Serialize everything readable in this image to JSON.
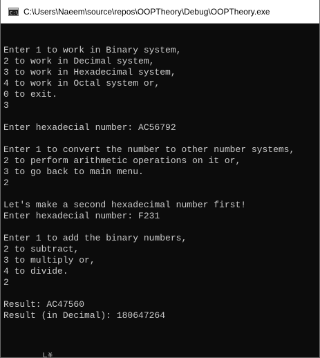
{
  "window": {
    "title": "C:\\Users\\Naeem\\source\\repos\\OOPTheory\\Debug\\OOPTheory.exe",
    "icon": "console-app-icon",
    "icon_glyph": "C:\\"
  },
  "console": {
    "lines": [
      "Enter 1 to work in Binary system,",
      "2 to work in Decimal system,",
      "3 to work in Hexadecimal system,",
      "4 to work in Octal system or,",
      "0 to exit.",
      "3",
      "",
      "Enter hexadecial number: AC56792",
      "",
      "Enter 1 to convert the number to other number systems,",
      "2 to perform arithmetic operations on it or,",
      "3 to go back to main menu.",
      "2",
      "",
      "Let's make a second hexadecimal number first!",
      "Enter hexadecial number: F231",
      "",
      "Enter 1 to add the binary numbers,",
      "2 to subtract,",
      "3 to multiply or,",
      "4 to divide.",
      "2",
      "",
      "Result: AC47560",
      "Result (in Decimal): 180647264"
    ]
  },
  "colors": {
    "console_background": "#0c0c0c",
    "console_text": "#cccccc",
    "titlebar_background": "#ffffff"
  }
}
